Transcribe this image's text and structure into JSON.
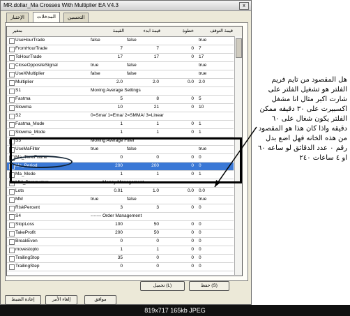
{
  "window": {
    "title": "MR.dollar_Ma Crosses With Multiplier EA V4.3",
    "close": "x"
  },
  "tabs": [
    {
      "label": "الإختبار",
      "active": false
    },
    {
      "label": "المدخلات",
      "active": true
    },
    {
      "label": "التحسين",
      "active": false
    }
  ],
  "columns": {
    "var": "متغير",
    "value": "القيمة",
    "start": "قيمة ابدء",
    "step": "خطوة",
    "stop": "قيمة التوقف"
  },
  "rows": [
    {
      "name": "UseHourTrade",
      "value": "false",
      "start": "false",
      "step": "",
      "stop": "true"
    },
    {
      "name": "FromHourTrade",
      "value": "7",
      "start": "7",
      "step": "0",
      "stop": "7"
    },
    {
      "name": "ToHourTrade",
      "value": "17",
      "start": "17",
      "step": "0",
      "stop": "17"
    },
    {
      "name": "CloseOppositeSignal",
      "value": "true",
      "start": "false",
      "step": "",
      "stop": "true"
    },
    {
      "name": "UseXMultiplier",
      "value": "false",
      "start": "false",
      "step": "",
      "stop": "true"
    },
    {
      "name": "Multiplier",
      "value": "2.0",
      "start": "2.0",
      "step": "0.0",
      "stop": "2.0"
    },
    {
      "name": "S1",
      "span": "Moving Average Settings"
    },
    {
      "name": "Fastma",
      "value": "5",
      "start": "8",
      "step": "0",
      "stop": "5"
    },
    {
      "name": "Slowma",
      "value": "10",
      "start": "21",
      "step": "0",
      "stop": "10"
    },
    {
      "name": "S2",
      "span": "0=Sma/ 1=Ema/ 2=SMMA/ 3=Linear"
    },
    {
      "name": "Fastma_Mode",
      "value": "1",
      "start": "1",
      "step": "0",
      "stop": "1"
    },
    {
      "name": "Slowma_Mode",
      "value": "1",
      "start": "1",
      "step": "0",
      "stop": "1"
    },
    {
      "name": "S3",
      "span": "Moving Average Filter"
    },
    {
      "name": "UseMaFilter",
      "value": "true",
      "start": "false",
      "step": "",
      "stop": "true"
    },
    {
      "name": "Ma_TimeFrame",
      "value": "0",
      "start": "0",
      "step": "0",
      "stop": "0"
    },
    {
      "name": "Ma_Period",
      "value": "200",
      "start": "200",
      "step": "0",
      "stop": "0",
      "selected": true
    },
    {
      "name": "Ma_Mode",
      "value": "1",
      "start": "1",
      "step": "0",
      "stop": "1"
    },
    {
      "name": "MM_Parameters",
      "span": "------- Money Management"
    },
    {
      "name": "Lots",
      "value": "0.01",
      "start": "1.0",
      "step": "0.0",
      "stop": "0.0"
    },
    {
      "name": "MM",
      "value": "true",
      "start": "false",
      "step": "",
      "stop": "true"
    },
    {
      "name": "RiskPercent",
      "value": "3",
      "start": "3",
      "step": "0",
      "stop": "0"
    },
    {
      "name": "S4",
      "span": "------- Order Management"
    },
    {
      "name": "StopLoss",
      "value": "100",
      "start": "50",
      "step": "0",
      "stop": "0"
    },
    {
      "name": "TakeProfit",
      "value": "200",
      "start": "50",
      "step": "0",
      "stop": "0"
    },
    {
      "name": "BreakEven",
      "value": "0",
      "start": "0",
      "step": "0",
      "stop": "0"
    },
    {
      "name": "movestopto",
      "value": "1",
      "start": "1",
      "step": "0",
      "stop": "0"
    },
    {
      "name": "TrailingStop",
      "value": "35",
      "start": "0",
      "step": "0",
      "stop": "0"
    },
    {
      "name": "TrailingStep",
      "value": "0",
      "start": "0",
      "step": "0",
      "stop": "0"
    }
  ],
  "buttons": {
    "load": "تحميل (L)",
    "save": "حفظ (S)",
    "ok": "موافق",
    "cancel": "إلغاء الأمر",
    "reset": "إعادة الضبط"
  },
  "note": "هل المقصود من تايم فريم الفلتر هو تشغيل الفلتر على شارت اكبر مثال انا مشغل اكسبيرت على ٣٠ دقيقه ممكن الفلتر يكون شغال على ٦٠ دقيقه واذا كان هذا هو المقصود من هذه الخانه فهل اضع بدل رقم ٠ عدد الدقائق لو ساعه ٦٠ او ٤ ساعات ٢٤٠",
  "footer": "819x717  165kb  JPEG",
  "colors": {
    "selection": "#3a78d6",
    "window_bg": "#ece9d8"
  }
}
